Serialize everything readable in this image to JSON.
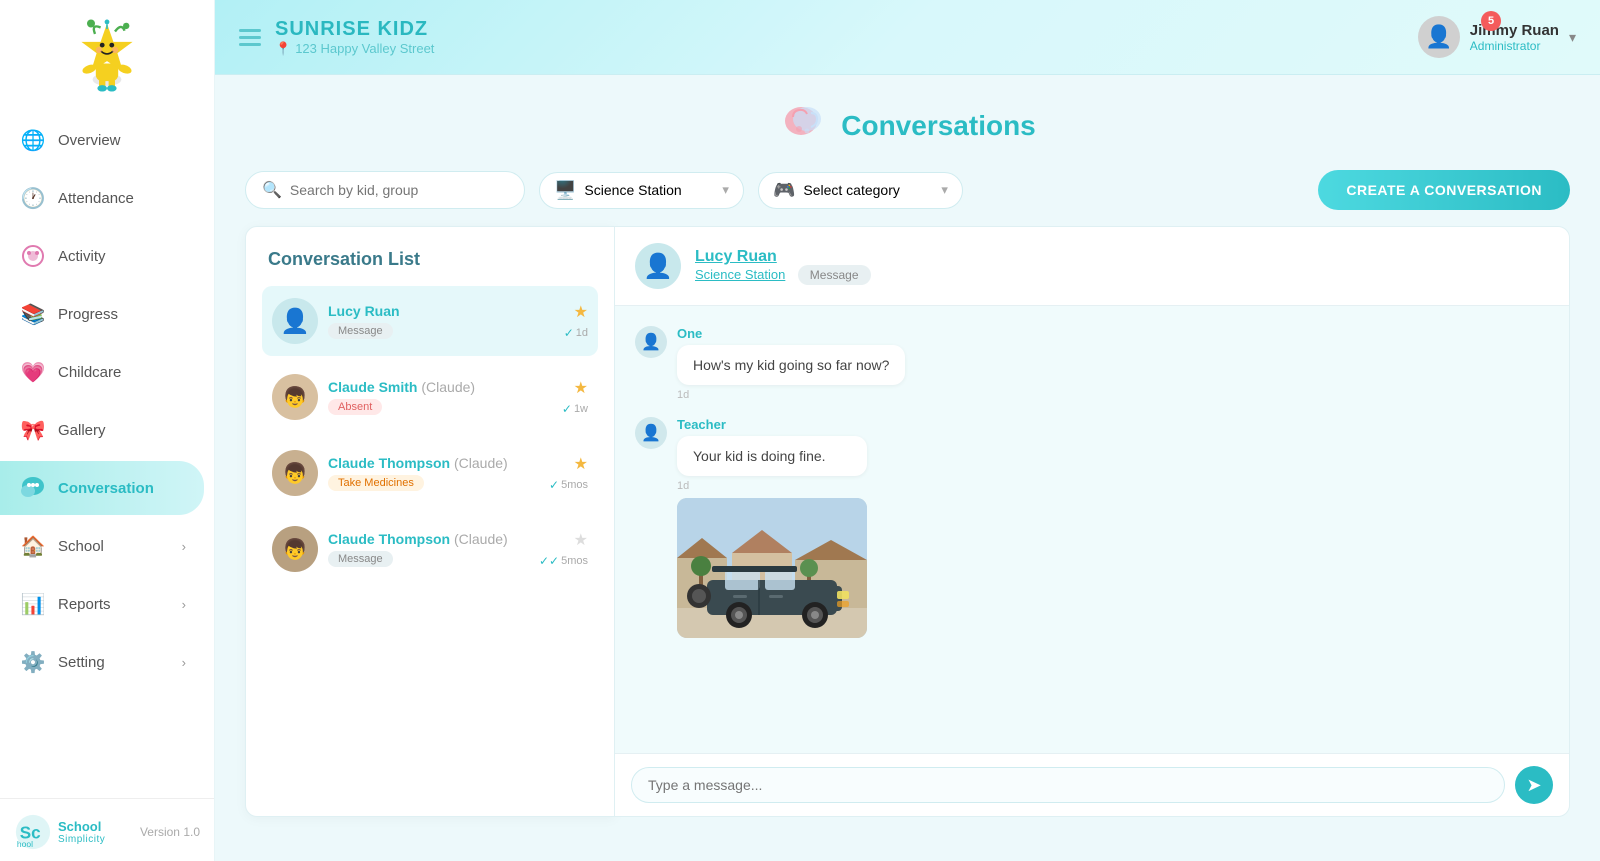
{
  "sidebar": {
    "nav_items": [
      {
        "id": "overview",
        "label": "Overview",
        "icon": "🌐",
        "active": false,
        "has_arrow": false
      },
      {
        "id": "attendance",
        "label": "Attendance",
        "icon": "🕐",
        "active": false,
        "has_arrow": false
      },
      {
        "id": "activity",
        "label": "Activity",
        "icon": "🌸",
        "active": false,
        "has_arrow": false
      },
      {
        "id": "progress",
        "label": "Progress",
        "icon": "📚",
        "active": false,
        "has_arrow": false
      },
      {
        "id": "childcare",
        "label": "Childcare",
        "icon": "💗",
        "active": false,
        "has_arrow": false
      },
      {
        "id": "gallery",
        "label": "Gallery",
        "icon": "🎀",
        "active": false,
        "has_arrow": false
      },
      {
        "id": "conversation",
        "label": "Conversation",
        "icon": "💬",
        "active": true,
        "has_arrow": false
      },
      {
        "id": "school",
        "label": "School",
        "icon": "🏠",
        "active": false,
        "has_arrow": true
      },
      {
        "id": "reports",
        "label": "Reports",
        "icon": "📊",
        "active": false,
        "has_arrow": true
      },
      {
        "id": "setting",
        "label": "Setting",
        "icon": "⚙️",
        "active": false,
        "has_arrow": true
      }
    ],
    "version": "Version 1.0"
  },
  "header": {
    "school_name": "SUNRISE KIDZ",
    "address": "123 Happy Valley Street",
    "user_name": "Jimmy Ruan",
    "user_role": "Administrator",
    "notification_count": "5"
  },
  "page": {
    "title": "Conversations",
    "title_icon": "🧠"
  },
  "toolbar": {
    "search_placeholder": "Search by kid, group",
    "group_selected": "Science Station",
    "category_placeholder": "Select category",
    "create_button": "CREATE A CONVERSATION"
  },
  "conversation_list": {
    "title": "Conversation List",
    "items": [
      {
        "id": 1,
        "name": "Lucy Ruan",
        "tag": "Message",
        "tag_type": "message",
        "starred": true,
        "time": "1d",
        "has_avatar": false,
        "selected": true
      },
      {
        "id": 2,
        "name": "Claude Smith",
        "name_paren": "(Claude)",
        "tag": "Absent",
        "tag_type": "absent",
        "starred": true,
        "time": "1w",
        "has_avatar": true,
        "selected": false
      },
      {
        "id": 3,
        "name": "Claude Thompson",
        "name_paren": "(Claude)",
        "tag": "Take Medicines",
        "tag_type": "medicine",
        "starred": true,
        "time": "5mos",
        "has_avatar": true,
        "selected": false
      },
      {
        "id": 4,
        "name": "Claude Thompson",
        "name_paren": "(Claude)",
        "tag": "Message",
        "tag_type": "message",
        "starred": false,
        "time": "5mos",
        "has_avatar": true,
        "selected": false
      }
    ]
  },
  "chat": {
    "contact_name": "Lucy Ruan",
    "contact_group": "Science Station",
    "contact_tag": "Message",
    "messages": [
      {
        "id": 1,
        "sender": "One",
        "sender_type": "parent",
        "text": "How's my kid going so far now?",
        "time": "1d",
        "has_image": false
      },
      {
        "id": 2,
        "sender": "Teacher",
        "sender_type": "teacher",
        "text": "Your kid is doing fine.",
        "time": "1d",
        "has_image": true
      }
    ],
    "image_alt": "Jeep vehicle photo"
  },
  "footer": {
    "brand": "School Simplicity"
  }
}
